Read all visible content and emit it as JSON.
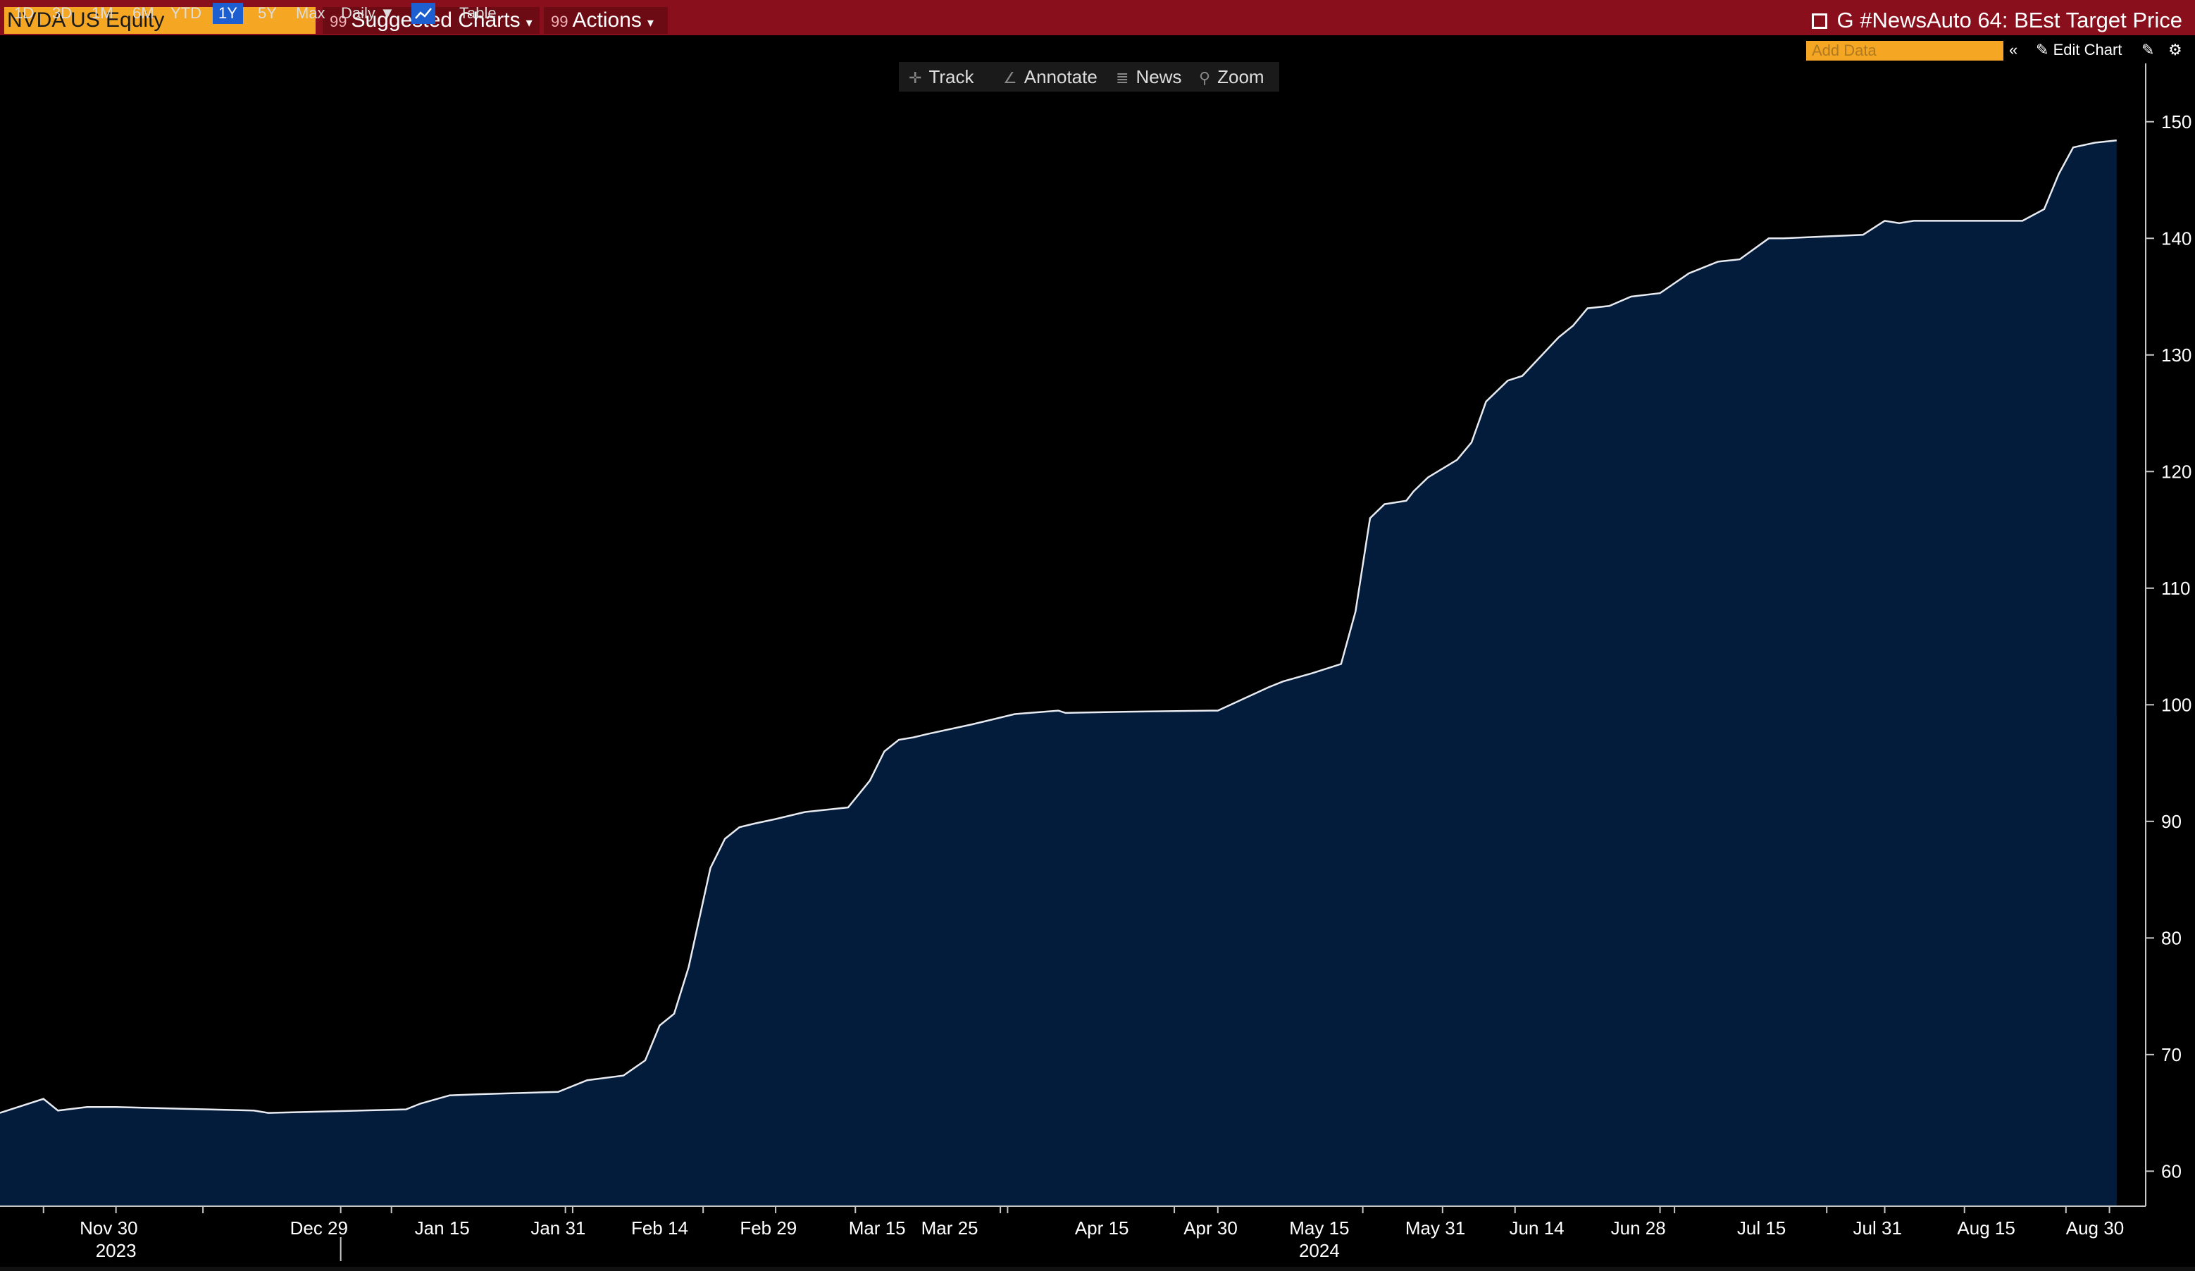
{
  "header": {
    "ticker": "NVDA US Equity",
    "suggested_charts": "Suggested Charts",
    "actions": "Actions",
    "title": "G #NewsAuto 64: BEst Target Price"
  },
  "toolbar": {
    "ranges": [
      "1D",
      "3D",
      "1M",
      "6M",
      "YTD",
      "1Y",
      "5Y",
      "Max"
    ],
    "active_range": "1Y",
    "frequency": "Daily",
    "table": "Table",
    "add_data_placeholder": "Add Data",
    "edit_chart": "Edit Chart"
  },
  "floatbar": {
    "track": "Track",
    "annotate": "Annotate",
    "news": "News",
    "zoom": "Zoom"
  },
  "colors": {
    "line": "#e8ecf2",
    "fill": "#041c3b",
    "background": "#000000",
    "header": "#8a0f1c",
    "ticker": "#f5a623",
    "accent": "#1d5fd1"
  },
  "chart_data": {
    "type": "area",
    "xlabel": "",
    "ylabel": "",
    "ylim": [
      57,
      155
    ],
    "y_ticks": [
      60,
      70,
      80,
      90,
      100,
      110,
      120,
      130,
      140,
      150
    ],
    "x_ticks": [
      "Nov 30",
      "Dec 29",
      "Jan 15",
      "Jan 31",
      "Feb 14",
      "Feb 29",
      "Mar 15",
      "Mar 25",
      "Apr 15",
      "Apr 30",
      "May 15",
      "May 31",
      "Jun 14",
      "Jun 28",
      "Jul 15",
      "Jul 31",
      "Aug 15",
      "Aug 30"
    ],
    "year_labels": [
      "2023",
      "2024"
    ],
    "x_ticks_dates": [
      "2023-11-30",
      "2023-12-29",
      "2024-01-15",
      "2024-01-31",
      "2024-02-14",
      "2024-02-29",
      "2024-03-15",
      "2024-03-25",
      "2024-04-15",
      "2024-04-30",
      "2024-05-15",
      "2024-05-31",
      "2024-06-14",
      "2024-06-28",
      "2024-07-15",
      "2024-07-31",
      "2024-08-15",
      "2024-08-30"
    ],
    "xlim": [
      "2023-11-15",
      "2024-09-06"
    ],
    "series": [
      {
        "x": [
          "2023-11-15",
          "2023-11-21",
          "2023-11-23",
          "2023-11-27",
          "2023-12-01",
          "2023-12-20",
          "2023-12-22",
          "2024-01-10",
          "2024-01-12",
          "2024-01-16",
          "2024-01-20",
          "2024-01-31",
          "2024-02-04",
          "2024-02-09",
          "2024-02-12",
          "2024-02-14",
          "2024-02-16",
          "2024-02-18",
          "2024-02-21",
          "2024-02-23",
          "2024-02-25",
          "2024-02-27",
          "2024-03-01",
          "2024-03-05",
          "2024-03-11",
          "2024-03-14",
          "2024-03-16",
          "2024-03-18",
          "2024-03-20",
          "2024-03-22",
          "2024-03-28",
          "2024-04-03",
          "2024-04-09",
          "2024-04-10",
          "2024-04-18",
          "2024-04-30",
          "2024-05-01",
          "2024-05-08",
          "2024-05-10",
          "2024-05-14",
          "2024-05-18",
          "2024-05-20",
          "2024-05-22",
          "2024-05-24",
          "2024-05-27",
          "2024-05-28",
          "2024-05-30",
          "2024-06-03",
          "2024-06-05",
          "2024-06-07",
          "2024-06-10",
          "2024-06-12",
          "2024-06-17",
          "2024-06-19",
          "2024-06-21",
          "2024-06-24",
          "2024-06-27",
          "2024-07-01",
          "2024-07-05",
          "2024-07-09",
          "2024-07-12",
          "2024-07-16",
          "2024-07-18",
          "2024-07-29",
          "2024-08-01",
          "2024-08-03",
          "2024-08-05",
          "2024-08-20",
          "2024-08-23",
          "2024-08-25",
          "2024-08-27",
          "2024-08-30",
          "2024-09-02"
        ],
        "y": [
          65,
          66.2,
          65.2,
          65.5,
          65.5,
          65.2,
          65,
          65.3,
          65.8,
          66.5,
          66.6,
          66.8,
          67.8,
          68.2,
          69.5,
          72.5,
          73.5,
          77.5,
          86,
          88.5,
          89.5,
          89.8,
          90.2,
          90.8,
          91.2,
          93.5,
          96,
          97,
          97.2,
          97.5,
          98.3,
          99.2,
          99.5,
          99.3,
          99.4,
          99.5,
          99.5,
          101.5,
          102,
          102.7,
          103.5,
          108,
          116,
          117.2,
          117.5,
          118.3,
          119.5,
          121,
          122.5,
          126,
          127.8,
          128.2,
          131.5,
          132.5,
          134,
          134.2,
          135,
          135.3,
          137,
          138,
          138.2,
          140,
          140,
          140.3,
          141.5,
          141.3,
          141.5,
          141.5,
          142.5,
          145.5,
          147.8,
          148.2,
          148.4
        ]
      }
    ]
  }
}
